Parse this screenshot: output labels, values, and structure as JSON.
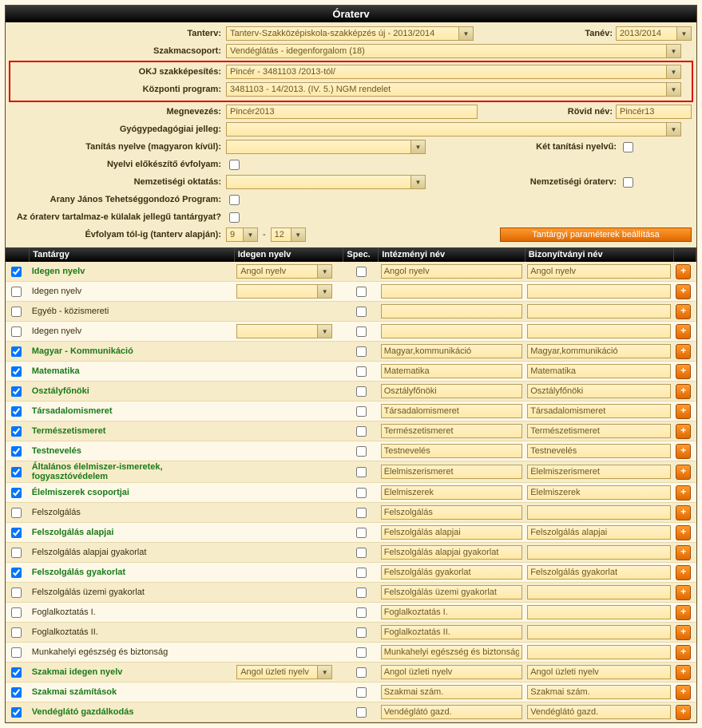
{
  "header": "Óraterv",
  "form": {
    "l_tanterv": "Tanterv:",
    "v_tanterv": "Tanterv-Szakközépiskola-szakképzés új - 2013/2014",
    "l_tanev": "Tanév:",
    "v_tanev": "2013/2014",
    "l_szakma": "Szakmacsoport:",
    "v_szakma": "Vendéglátás - idegenforgalom (18)",
    "l_okj": "OKJ szakképesítés:",
    "v_okj": "Pincér - 3481103 /2013-tól/",
    "l_kozp": "Központi program:",
    "v_kozp": "3481103 - 14/2013. (IV. 5.) NGM rendelet",
    "l_megnev": "Megnevezés:",
    "v_megnev": "Pincér2013",
    "l_rovid": "Rövid név:",
    "v_rovid": "Pincér13",
    "l_gyogy": "Gyógypedagógiai jelleg:",
    "l_tanitas": "Tanítás nyelve (magyaron kívül):",
    "l_ket": "Két tanítási nyelvű:",
    "l_nyelvi": "Nyelvi előkészítő évfolyam:",
    "l_nemz": "Nemzetiségi oktatás:",
    "l_nemz_ora": "Nemzetiségi óraterv:",
    "l_arany": "Arany János Tehetséggondozó Program:",
    "l_kulalak": "Az óraterv tartalmaz-e külalak jellegű tantárgyat?",
    "l_evfolyam": "Évfolyam tól-ig (tanterv alapján):",
    "v_ev_from": "9",
    "v_ev_to": "12",
    "btn_param": "Tantárgyi paraméterek beállítása"
  },
  "thead": {
    "c1": "Tantárgy",
    "c2": "Idegen nyelv",
    "c3": "Spec.",
    "c4": "Intézményi név",
    "c5": "Bizonyítványi név"
  },
  "lang_options": {
    "angol": "Angol nyelv",
    "angol_uzleti": "Angol üzleti nyelv"
  },
  "rows": [
    {
      "chk": true,
      "green": true,
      "name": "Idegen nyelv",
      "lang": "angol",
      "spec": false,
      "inst": "Angol nyelv",
      "cert": "Angol nyelv"
    },
    {
      "chk": false,
      "green": false,
      "name": "Idegen nyelv",
      "lang": "",
      "spec": false,
      "inst": "",
      "cert": ""
    },
    {
      "chk": false,
      "green": false,
      "name": "Egyéb - közismereti",
      "lang": null,
      "spec": false,
      "inst": "",
      "cert": ""
    },
    {
      "chk": false,
      "green": false,
      "name": "Idegen nyelv",
      "lang": "",
      "spec": false,
      "inst": "",
      "cert": ""
    },
    {
      "chk": true,
      "green": true,
      "name": "Magyar - Kommunikáció",
      "lang": null,
      "spec": false,
      "inst": "Magyar,kommunikáció",
      "cert": "Magyar,kommunikáció"
    },
    {
      "chk": true,
      "green": true,
      "name": "Matematika",
      "lang": null,
      "spec": false,
      "inst": "Matematika",
      "cert": "Matematika"
    },
    {
      "chk": true,
      "green": true,
      "name": "Osztályfőnöki",
      "lang": null,
      "spec": false,
      "inst": "Osztályfőnöki",
      "cert": "Osztályfőnöki"
    },
    {
      "chk": true,
      "green": true,
      "name": "Társadalomismeret",
      "lang": null,
      "spec": false,
      "inst": "Társadalomismeret",
      "cert": "Társadalomismeret"
    },
    {
      "chk": true,
      "green": true,
      "name": "Természetismeret",
      "lang": null,
      "spec": false,
      "inst": "Természetismeret",
      "cert": "Természetismeret"
    },
    {
      "chk": true,
      "green": true,
      "name": "Testnevelés",
      "lang": null,
      "spec": false,
      "inst": "Testnevelés",
      "cert": "Testnevelés"
    },
    {
      "chk": true,
      "green": true,
      "name": "Általános élelmiszer-ismeretek, fogyasztóvédelem",
      "lang": null,
      "spec": false,
      "inst": "Élelmiszerismeret",
      "cert": "Élelmiszerismeret"
    },
    {
      "chk": true,
      "green": true,
      "name": "Élelmiszerek csoportjai",
      "lang": null,
      "spec": false,
      "inst": "Élelmiszerek",
      "cert": "Élelmiszerek"
    },
    {
      "chk": false,
      "green": false,
      "name": "Felszolgálás",
      "lang": null,
      "spec": false,
      "inst": "Felszolgálás",
      "cert": ""
    },
    {
      "chk": true,
      "green": true,
      "name": "Felszolgálás alapjai",
      "lang": null,
      "spec": false,
      "inst": "Felszolgálás alapjai",
      "cert": "Felszolgálás alapjai"
    },
    {
      "chk": false,
      "green": false,
      "name": "Felszolgálás alapjai gyakorlat",
      "lang": null,
      "spec": false,
      "inst": "Felszolgálás alapjai gyakorlat",
      "cert": ""
    },
    {
      "chk": true,
      "green": true,
      "name": "Felszolgálás gyakorlat",
      "lang": null,
      "spec": false,
      "inst": "Felszolgálás gyakorlat",
      "cert": "Felszolgálás gyakorlat"
    },
    {
      "chk": false,
      "green": false,
      "name": "Felszolgálás üzemi gyakorlat",
      "lang": null,
      "spec": false,
      "inst": "Felszolgálás üzemi gyakorlat",
      "cert": ""
    },
    {
      "chk": false,
      "green": false,
      "name": "Foglalkoztatás I.",
      "lang": null,
      "spec": false,
      "inst": "Foglalkoztatás I.",
      "cert": ""
    },
    {
      "chk": false,
      "green": false,
      "name": "Foglalkoztatás II.",
      "lang": null,
      "spec": false,
      "inst": "Foglalkoztatás II.",
      "cert": ""
    },
    {
      "chk": false,
      "green": false,
      "name": "Munkahelyi egészség és biztonság",
      "lang": null,
      "spec": false,
      "inst": "Munkahelyi egészség és biztonság",
      "cert": ""
    },
    {
      "chk": true,
      "green": true,
      "name": "Szakmai idegen nyelv",
      "lang": "angol_uzleti",
      "spec": false,
      "inst": "Angol üzleti nyelv",
      "cert": "Angol üzleti nyelv"
    },
    {
      "chk": true,
      "green": true,
      "name": "Szakmai számítások",
      "lang": null,
      "spec": false,
      "inst": "Szakmai szám.",
      "cert": "Szakmai szám."
    },
    {
      "chk": true,
      "green": true,
      "name": "Vendéglátó gazdálkodás",
      "lang": null,
      "spec": false,
      "inst": "Vendéglátó gazd.",
      "cert": "Vendéglátó gazd."
    }
  ]
}
